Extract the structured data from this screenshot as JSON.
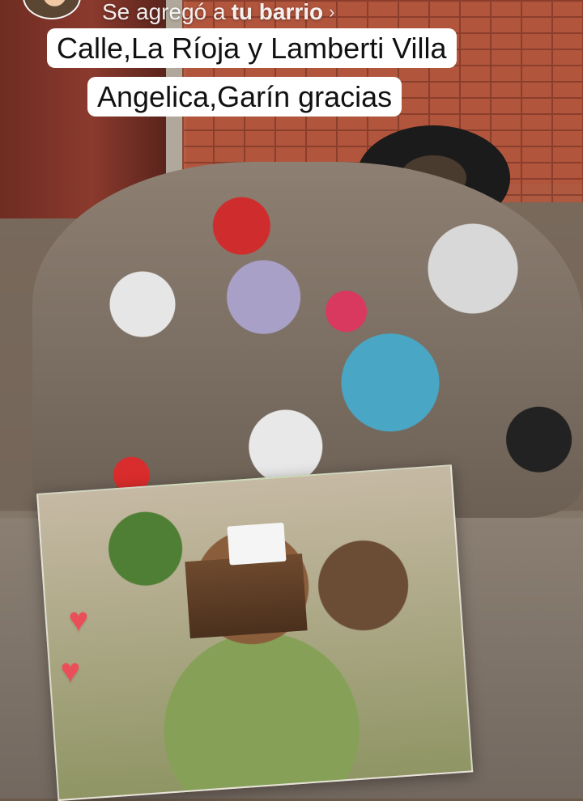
{
  "header": {
    "text_prefix": "Se agregó a ",
    "text_highlight": "tu barrio",
    "chevron_icon": "›"
  },
  "caption": {
    "line1": "Calle,La Ríoja y Lamberti Villa",
    "line2": "Angelica,Garín gracias"
  },
  "hearts": [
    "♥",
    "♥"
  ]
}
